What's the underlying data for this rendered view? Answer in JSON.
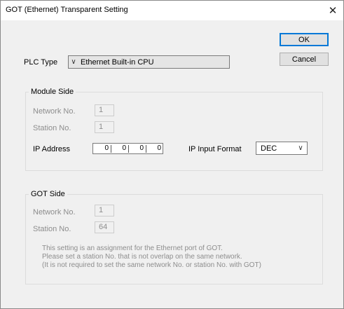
{
  "window": {
    "title": "GOT (Ethernet) Transparent Setting"
  },
  "buttons": {
    "ok": "OK",
    "cancel": "Cancel"
  },
  "plc_type": {
    "label": "PLC Type",
    "value": "Ethernet Built-in CPU"
  },
  "module_side": {
    "title": "Module Side",
    "network_label": "Network No.",
    "network_value": "1",
    "station_label": "Station No.",
    "station_value": "1",
    "ip_label": "IP Address",
    "ip_octets": [
      "0",
      "0",
      "0",
      "0"
    ],
    "ip_format_label": "IP Input Format",
    "ip_format_value": "DEC"
  },
  "got_side": {
    "title": "GOT Side",
    "network_label": "Network No.",
    "network_value": "1",
    "station_label": "Station No.",
    "station_value": "64",
    "note_lines": [
      "This setting is an assignment for the Ethernet port of GOT.",
      "Please set a station No. that is not overlap on the same network.",
      "(It is not required to set the same network No. or station No. with GOT)"
    ]
  }
}
